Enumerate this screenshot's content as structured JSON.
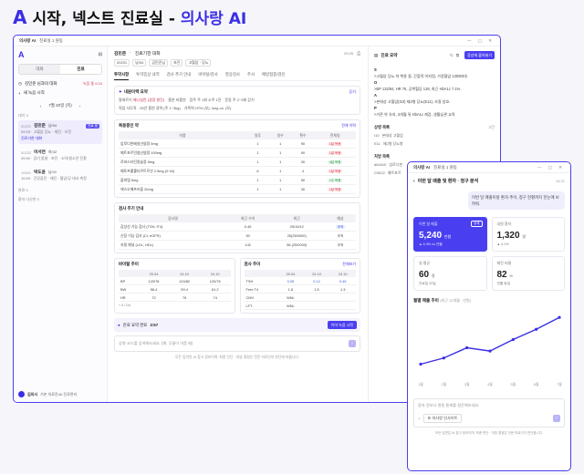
{
  "banner": {
    "part1": "시작, 넥스트 진료실 -",
    "part2": "의사랑 AI"
  },
  "window1": {
    "title": "의사랑 AI",
    "subtitle": "진료실 1 원동"
  },
  "sidebar": {
    "tab_chat": "대화",
    "tab_visit": "진료",
    "item1": "김민준 님과의 대화",
    "item1_badge": "녹음 중 0:24",
    "new_record": "새 녹음 시작",
    "date": "7월 20일 (목)",
    "section_waiting": "대기 3",
    "patients": [
      {
        "id": "00231",
        "name": "김민준",
        "meta": "남/54",
        "badge": "진료 중",
        "line2": "09:25 · 고혈압 당뇨 · 재진 · 오전",
        "line3": "진료기한 대화"
      },
      {
        "id": "00232",
        "name": "이서연",
        "meta": "여/32",
        "badge": "",
        "line2": "09:40 · 감기 몸살 · 초진 · 소아/청소년 진찰",
        "line3": ""
      },
      {
        "id": "10001",
        "name": "박도윤",
        "meta": "남/41",
        "badge": "",
        "line2": "10:00 · 건강검진 · 재진 · 혈압/당 대사 측정",
        "line3": ""
      }
    ],
    "section_done": "완료 0",
    "section_hold": "환자 다산한 0",
    "user_name": "김의사",
    "user_sub": "기본 의료진/AI 진료관리"
  },
  "main": {
    "patient_name": "김민준",
    "visit_label": "진료기한 대화",
    "time": "09:25",
    "tags": [
      "00231",
      "남/54",
      "김민준님",
      "초진",
      "고혈압 · 당뇨"
    ],
    "tabs": [
      "투약사항",
      "투약증상 내역",
      "검사 추가 안내",
      "바이탈/검사",
      "영상검사",
      "주사",
      "예방접종/검진"
    ],
    "ai_summary_title": "내원이력 요약",
    "ai_summary_link": "닫기",
    "kv1": [
      {
        "k": "알레르기",
        "v": "페니실린 (경증 발진)"
      },
      {
        "k": "흡연",
        "v": "비흡연"
      },
      {
        "k": "음주",
        "v": "주 1회 소주 1잔"
      },
      {
        "k": "운동",
        "v": "주 2~3회 걷기"
      }
    ],
    "kv2": [
      {
        "k": "직업",
        "v": "사무직 · 25년 흡연 경력 (주 1~3kg)"
      },
      {
        "k": "가족력",
        "v": "HTN (부), lung ca. (모)"
      }
    ],
    "med_title": "복용중인 약",
    "med_link": "전체 이력",
    "med_headers": [
      "약품",
      "일투",
      "일수",
      "횟수",
      "전체일"
    ],
    "meds": [
      {
        "name": "암로디핀베실산염정 5mg",
        "a": "1",
        "b": "1",
        "c": "90",
        "tag": "1달 복용",
        "tc": "red"
      },
      {
        "name": "메트포르민염산염정 100mg",
        "a": "1",
        "b": "1",
        "c": "90",
        "tag": "1달 복용",
        "tc": "red"
      },
      {
        "name": "로바스타틴칼슘정 5mg",
        "a": "1",
        "b": "1",
        "c": "30",
        "tag": "4달 복용",
        "tc": "green"
      },
      {
        "name": "메토프롤롤타르트르산 2.5mg (0·16)",
        "a": "6",
        "b": "1",
        "c": "4",
        "tag": "1달 복용",
        "tc": "red"
      },
      {
        "name": "졸피뎀 5mg",
        "a": "1",
        "b": "1",
        "c": "90",
        "tag": "1주 복용",
        "tc": "green"
      },
      {
        "name": "에스오메프라졸 20mg",
        "a": "1",
        "b": "1",
        "c": "30",
        "tag": "1달 복용",
        "tc": "red"
      }
    ],
    "lab_title": "검사 주기 안내",
    "lab_headers": [
      "검사명",
      "최근 수치",
      "최근",
      "예상"
    ],
    "labs": [
      {
        "name": "갑상선 기능 검사 (TSH, fT4)",
        "v": "0.45",
        "d": "25/10/12",
        "t": "추적",
        "tc": "blue"
      },
      {
        "name": "신장 기능 검사 (Cr, eGFR)",
        "v": "50",
        "d": "25(25/0000)",
        "t": "추적",
        "tc": "plain"
      },
      {
        "name": "지질 패널 (LDL, HDL)",
        "v": "142",
        "d": "56 (25/0000)",
        "t": "추적",
        "tc": "plain"
      }
    ],
    "vital_title": "바이탈 추이",
    "vital_dates": [
      "25.04",
      "24.10",
      "24.10"
    ],
    "vitals": [
      {
        "k": "BP",
        "v": [
          "120/78",
          "124/82",
          "120/76"
        ]
      },
      {
        "k": "BW",
        "v": [
          "58.4",
          "59.4",
          "61.2"
        ]
      },
      {
        "k": "HR",
        "v": [
          "72",
          "76",
          "74"
        ]
      }
    ],
    "vital_more": "+ 5 / DA",
    "test_title": "검사 추이",
    "test_link": "전체보기",
    "test_dates": [
      "25.04",
      "24.10",
      "24.10"
    ],
    "tests": [
      {
        "k": "TSH",
        "v": [
          "0.05",
          "0.12",
          "0.45"
        ]
      },
      {
        "k": "Free T4",
        "v": [
          "1.8",
          "1.5",
          "1.3"
        ]
      },
      {
        "k": "CMV",
        "v": [
          "WNL",
          "",
          ""
        ]
      },
      {
        "k": "LFT",
        "v": [
          "WNL",
          "",
          ""
        ]
      }
    ],
    "summary_label": "진료 요약 완료",
    "summary_time": "3:57",
    "summary_btn": "이어 녹음 시작",
    "input_placeholder": "상병 코드를 검색해보세요. (예: 무릎이 아픔 때)",
    "footer": "모든 입력된 AI 참고 정보이며, 최종 진단 · 처방 결정은 전문 의료인의 판단에 따릅니다."
  },
  "right": {
    "title": "진료 요약",
    "btn": "증상에 붙여넣기",
    "soap": [
      {
        "k": "S",
        "v": ">고혈압 당뇨 약 복용 중, 간헐적 어지럼, 가정혈압 130/80대."
      },
      {
        "k": "O",
        "v": ">BP 132/84, HR 76, 공복혈당 128, 최근 HbA1c 7.1%."
      },
      {
        "k": "A",
        "v": ">본태성 고혈압(I10) 제2형 당뇨(E11), 조절 양호."
      },
      {
        "k": "P",
        "v": ">기존 약 유지, 3개월 뒤 HbA1c 재검, 생활습관 교육"
      }
    ],
    "dx_title": "상병 목록",
    "dx_count": "2건",
    "dx": [
      {
        "code": "I10",
        "name": "본태성 고혈압"
      },
      {
        "code": "E11",
        "name": "제2형 당뇨병"
      }
    ],
    "rx_title": "처방 목록",
    "rx": [
      {
        "code": "d64410",
        "name": "암로디핀"
      },
      {
        "code": "C9022",
        "name": "메트포르"
      }
    ]
  },
  "window2": {
    "title": "의사랑 AI",
    "subtitle": "진료실 1 원동"
  },
  "analysis": {
    "title": "이번 달 매출 및 환자 · 청구 분석",
    "time": "14:21",
    "question": "이번 달 매출이랑 환자 추이, 청구 현황까지 한눈에 보여줘.",
    "cards": [
      {
        "label": "이번 달 매출",
        "value": "5,240",
        "unit": "만원",
        "sub": "▲ 6.4% vs 전월",
        "pill": "상세",
        "hl": true
      },
      {
        "label": "내원 환자",
        "value": "1,320",
        "unit": "명",
        "sub": "▲ 4.1%",
        "hl": false
      },
      {
        "label": "일 평균",
        "value": "60",
        "unit": "명",
        "sub": "진료일 22일",
        "hl": false
      },
      {
        "label": "재진 비율",
        "value": "82",
        "unit": "%",
        "sub": "전월 동일",
        "hl": false
      }
    ],
    "chart_title": "월별 매출 추이",
    "chart_sub": "(최근 12개월 · 만원)",
    "input_placeholder": "환자 정보나 병원 통계를 질문해보세요.",
    "chip": "의사랑 인사이트",
    "footer": "모든 답변은 AI 참고 정보이며, 최종 판단 · 처방 결정은 전문 의료인이 판단합니다."
  },
  "chart_data": {
    "type": "line",
    "title": "월별 매출 추이",
    "x": [
      "1월",
      "2월",
      "3월",
      "4월",
      "5월",
      "6월",
      "7월"
    ],
    "values": [
      4100,
      4250,
      4500,
      4420,
      4700,
      4950,
      5240
    ],
    "ylim": [
      3800,
      5400
    ],
    "grid": false
  }
}
